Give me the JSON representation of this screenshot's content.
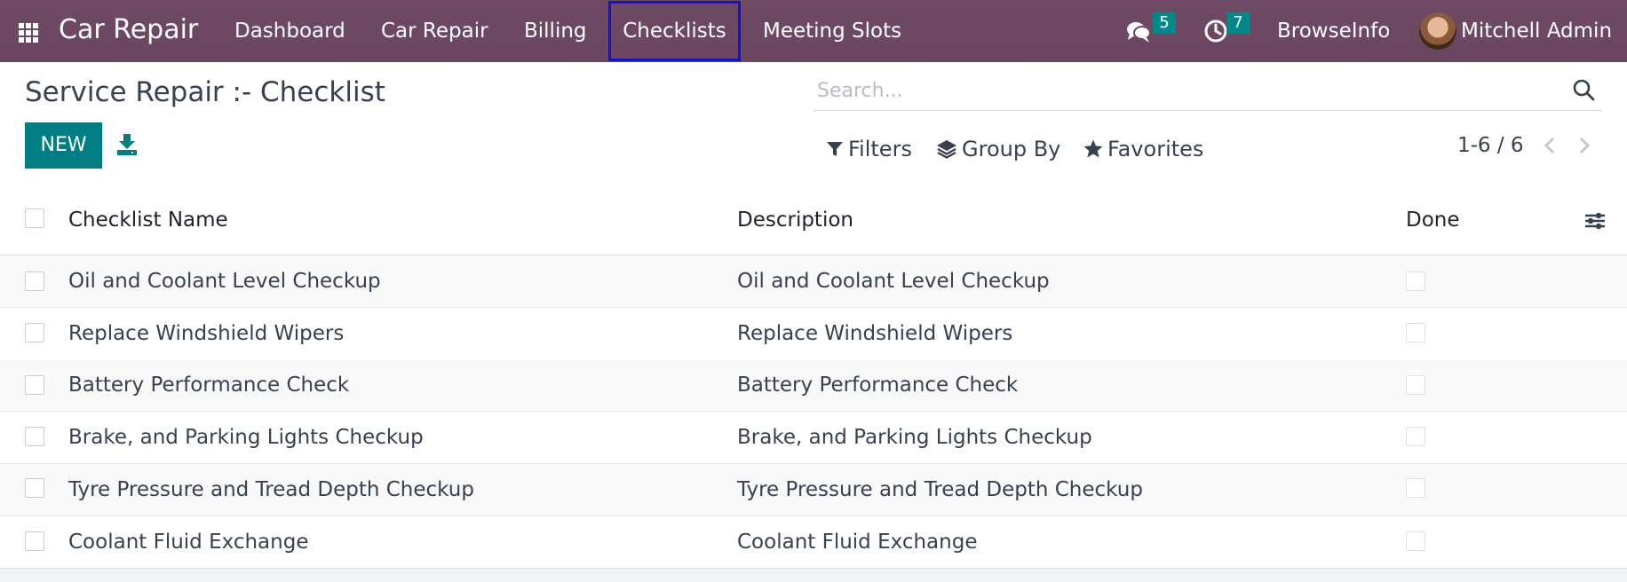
{
  "navbar": {
    "brand": "Car Repair",
    "menu": [
      {
        "label": "Dashboard"
      },
      {
        "label": "Car Repair"
      },
      {
        "label": "Billing"
      },
      {
        "label": "Checklists"
      },
      {
        "label": "Meeting Slots"
      }
    ],
    "active_menu": "Checklists",
    "messages_count": "5",
    "activities_count": "7",
    "company": "BrowseInfo",
    "user": "Mitchell Admin",
    "icons": {
      "apps": "apps-grid-icon",
      "messages": "chat-bubbles-icon",
      "activities": "clock-icon"
    }
  },
  "control_panel": {
    "title": "Service Repair :- Checklist",
    "new_label": "NEW",
    "search_placeholder": "Search...",
    "filters_label": "Filters",
    "group_by_label": "Group By",
    "favorites_label": "Favorites",
    "pager": "1-6 / 6"
  },
  "list": {
    "columns": {
      "name": "Checklist Name",
      "description": "Description",
      "done": "Done"
    },
    "rows": [
      {
        "name": "Oil and Coolant Level Checkup",
        "description": "Oil and Coolant Level Checkup",
        "done": false
      },
      {
        "name": "Replace Windshield Wipers",
        "description": "Replace Windshield Wipers",
        "done": false
      },
      {
        "name": "Battery Performance Check",
        "description": "Battery Performance Check",
        "done": false
      },
      {
        "name": "Brake, and Parking Lights Checkup",
        "description": "Brake, and Parking Lights Checkup",
        "done": false
      },
      {
        "name": "Tyre Pressure and Tread Depth Checkup",
        "description": "Tyre Pressure and Tread Depth Checkup",
        "done": false
      },
      {
        "name": "Coolant Fluid Exchange",
        "description": "Coolant Fluid Exchange",
        "done": false
      }
    ]
  },
  "colors": {
    "navbar": "#714b67",
    "primary": "#017e84",
    "badge": "#00898a",
    "active_outline": "#1010e0"
  }
}
